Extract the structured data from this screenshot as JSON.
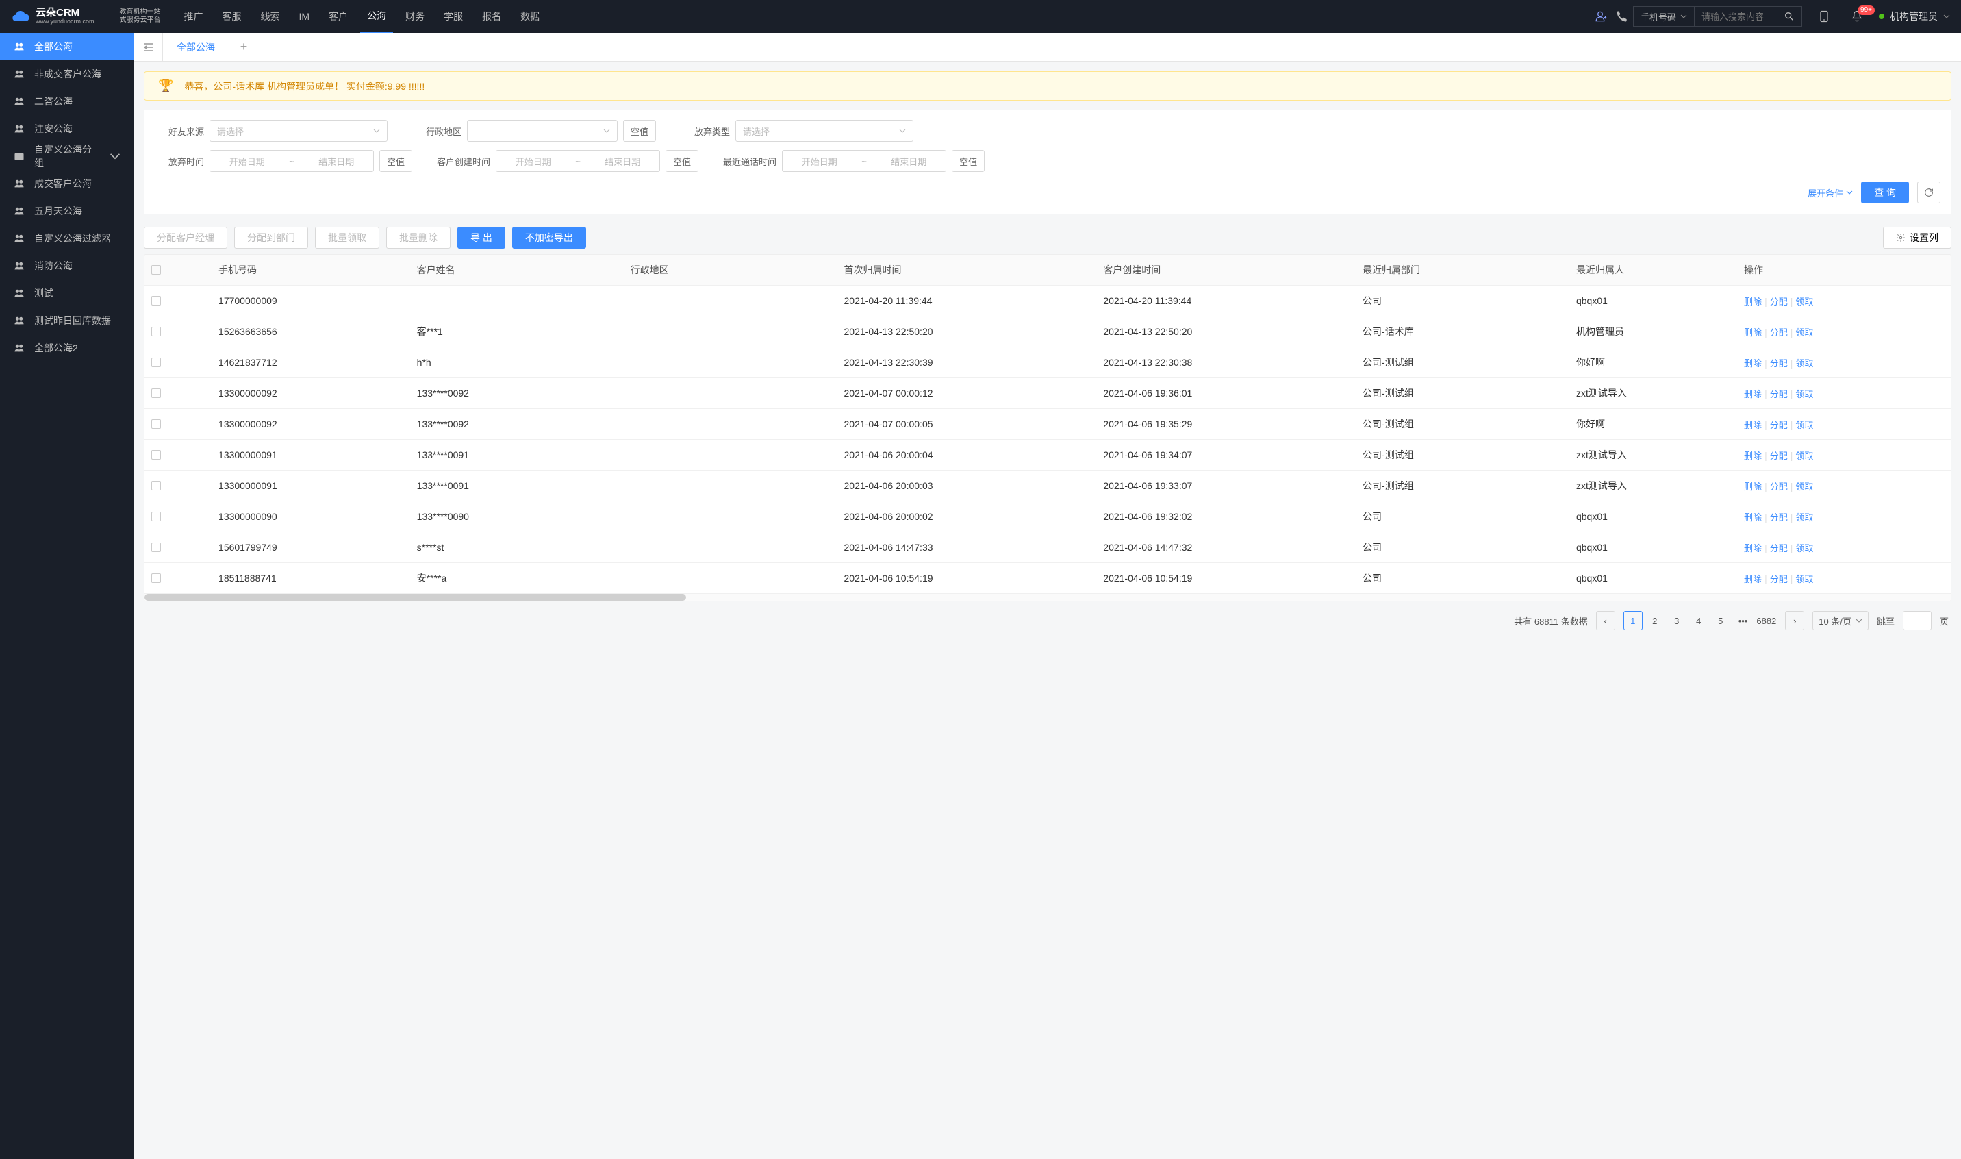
{
  "brand": {
    "name": "云朵CRM",
    "url": "www.yunduocrm.com",
    "tag1": "教育机构一站",
    "tag2": "式服务云平台"
  },
  "nav": [
    "推广",
    "客服",
    "线索",
    "IM",
    "客户",
    "公海",
    "财务",
    "学服",
    "报名",
    "数据"
  ],
  "nav_active": "公海",
  "header": {
    "search_type": "手机号码",
    "search_placeholder": "请输入搜索内容",
    "notif_count": "99+",
    "user": "机构管理员"
  },
  "sidebar": [
    {
      "label": "全部公海",
      "icon": "group",
      "active": true
    },
    {
      "label": "非成交客户公海",
      "icon": "group"
    },
    {
      "label": "二咨公海",
      "icon": "group"
    },
    {
      "label": "注安公海",
      "icon": "group"
    },
    {
      "label": "自定义公海分组",
      "icon": "folder",
      "expandable": true
    },
    {
      "label": "成交客户公海",
      "icon": "group"
    },
    {
      "label": "五月天公海",
      "icon": "group"
    },
    {
      "label": "自定义公海过滤器",
      "icon": "group"
    },
    {
      "label": "消防公海",
      "icon": "group"
    },
    {
      "label": "测试",
      "icon": "group"
    },
    {
      "label": "测试昨日回库数据",
      "icon": "group"
    },
    {
      "label": "全部公海2",
      "icon": "group"
    }
  ],
  "tabs": {
    "active": "全部公海"
  },
  "banner": "恭喜，公司-话术库  机构管理员成单！  实付金额:9.99 !!!!!!",
  "filters": {
    "friend_source": {
      "label": "好友来源",
      "placeholder": "请选择"
    },
    "region": {
      "label": "行政地区",
      "placeholder": "",
      "null": "空值"
    },
    "abandon_type": {
      "label": "放弃类型",
      "placeholder": "请选择"
    },
    "abandon_time": {
      "label": "放弃时间",
      "start": "开始日期",
      "end": "结束日期",
      "null": "空值"
    },
    "create_time": {
      "label": "客户创建时间",
      "start": "开始日期",
      "end": "结束日期",
      "null": "空值"
    },
    "call_time": {
      "label": "最近通话时间",
      "start": "开始日期",
      "end": "结束日期",
      "null": "空值"
    },
    "expand": "展开条件",
    "query": "查 询"
  },
  "toolbar": {
    "assign_mgr": "分配客户经理",
    "assign_dept": "分配到部门",
    "batch_claim": "批量领取",
    "batch_delete": "批量删除",
    "export": "导 出",
    "export_plain": "不加密导出",
    "set_cols": "设置列"
  },
  "table": {
    "cols": [
      "手机号码",
      "客户姓名",
      "行政地区",
      "首次归属时间",
      "客户创建时间",
      "最近归属部门",
      "最近归属人",
      "操作"
    ],
    "ops": {
      "delete": "删除",
      "assign": "分配",
      "claim": "领取"
    },
    "rows": [
      {
        "phone": "17700000009",
        "name": "",
        "region": "",
        "first": "2021-04-20 11:39:44",
        "create": "2021-04-20 11:39:44",
        "dept": "公司",
        "owner": "qbqx01"
      },
      {
        "phone": "15263663656",
        "name": "客***1",
        "region": "",
        "first": "2021-04-13 22:50:20",
        "create": "2021-04-13 22:50:20",
        "dept": "公司-话术库",
        "owner": "机构管理员"
      },
      {
        "phone": "14621837712",
        "name": "h*h",
        "region": "",
        "first": "2021-04-13 22:30:39",
        "create": "2021-04-13 22:30:38",
        "dept": "公司-测试组",
        "owner": "你好啊"
      },
      {
        "phone": "13300000092",
        "name": "133****0092",
        "region": "",
        "first": "2021-04-07 00:00:12",
        "create": "2021-04-06 19:36:01",
        "dept": "公司-测试组",
        "owner": "zxt测试导入"
      },
      {
        "phone": "13300000092",
        "name": "133****0092",
        "region": "",
        "first": "2021-04-07 00:00:05",
        "create": "2021-04-06 19:35:29",
        "dept": "公司-测试组",
        "owner": "你好啊"
      },
      {
        "phone": "13300000091",
        "name": "133****0091",
        "region": "",
        "first": "2021-04-06 20:00:04",
        "create": "2021-04-06 19:34:07",
        "dept": "公司-测试组",
        "owner": "zxt测试导入"
      },
      {
        "phone": "13300000091",
        "name": "133****0091",
        "region": "",
        "first": "2021-04-06 20:00:03",
        "create": "2021-04-06 19:33:07",
        "dept": "公司-测试组",
        "owner": "zxt测试导入"
      },
      {
        "phone": "13300000090",
        "name": "133****0090",
        "region": "",
        "first": "2021-04-06 20:00:02",
        "create": "2021-04-06 19:32:02",
        "dept": "公司",
        "owner": "qbqx01"
      },
      {
        "phone": "15601799749",
        "name": "s****st",
        "region": "",
        "first": "2021-04-06 14:47:33",
        "create": "2021-04-06 14:47:32",
        "dept": "公司",
        "owner": "qbqx01"
      },
      {
        "phone": "18511888741",
        "name": "安****a",
        "region": "",
        "first": "2021-04-06 10:54:19",
        "create": "2021-04-06 10:54:19",
        "dept": "公司",
        "owner": "qbqx01"
      }
    ]
  },
  "pagination": {
    "total_text_prefix": "共有 ",
    "total": "68811",
    "total_text_suffix": " 条数据",
    "pages": [
      "1",
      "2",
      "3",
      "4",
      "5"
    ],
    "last": "6882",
    "per_page": "10 条/页",
    "jump_label": "跳至",
    "page_suffix": "页"
  }
}
